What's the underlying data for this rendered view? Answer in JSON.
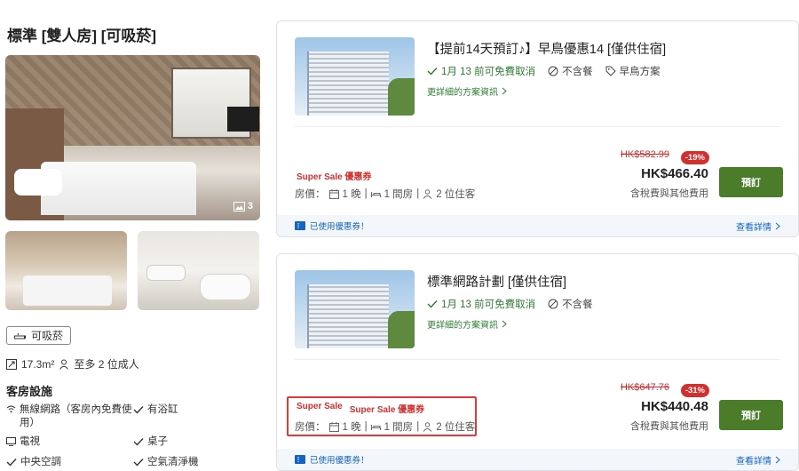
{
  "room": {
    "title": "標準 [雙人房] [可吸菸]",
    "photo_count": "3",
    "smoking_tag": "可吸菸",
    "size": "17.3m²",
    "capacity": "至多 2 位成人",
    "facilities_title": "客房設施",
    "facilities": [
      "無線網路（客房內免費使",
      "用）",
      "有浴缸",
      "電視",
      "桌子",
      "中央空調",
      "空氣清淨機"
    ]
  },
  "plans": [
    {
      "title": "【提前14天預訂♪】早鳥優惠14 [僅供住宿]",
      "cancel": "1月 13 前可免費取消",
      "meal": "不含餐",
      "extra": "早鳥方案",
      "details_link": "更詳細的方案資訊",
      "sale_tags": [
        "Super Sale 優惠券"
      ],
      "rate_label": "房價：",
      "nights": "1 晚",
      "rooms": "1 間房",
      "guests": "2 位住客",
      "original_price": "HK$582.99",
      "discount": "-19%",
      "price": "HK$466.40",
      "tax_note": "含稅費與其他費用",
      "book_label": "預訂",
      "coupon_used": "已使用優惠券！",
      "view_details": "查看詳情"
    },
    {
      "title": "標準網路計劃 [僅供住宿]",
      "cancel": "1月 13 前可免費取消",
      "meal": "不含餐",
      "details_link": "更詳細的方案資訊",
      "sale_tags": [
        "Super Sale",
        "Super Sale 優惠券"
      ],
      "rate_label": "房價：",
      "nights": "1 晚",
      "rooms": "1 間房",
      "guests": "2 位住客",
      "original_price": "HK$647.76",
      "discount": "-31%",
      "price": "HK$440.48",
      "tax_note": "含稅費與其他費用",
      "book_label": "預訂",
      "coupon_used": "已使用優惠券！",
      "view_details": "查看詳情"
    }
  ],
  "colors": {
    "accent_green": "#4a7c2a",
    "sale_red": "#d32f2f",
    "link_blue": "#1565c0",
    "highlight_red": "#e53935"
  }
}
